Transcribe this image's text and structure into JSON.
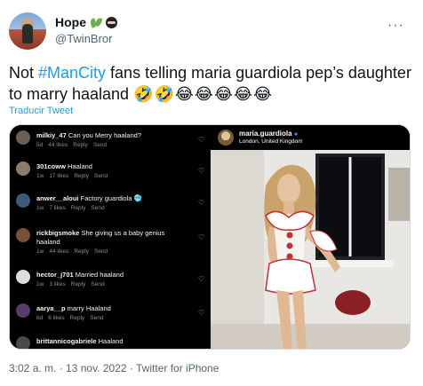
{
  "author": {
    "name": "Hope",
    "handle": "@TwinBror"
  },
  "more_label": "···",
  "tweet": {
    "text_before": "Not ",
    "hashtag": "#ManCity",
    "text_after": " fans telling maria guardiola pep’s daughter to marry haaland ",
    "emojis": "🤣🤣😂😂😂😂😂",
    "translate_label": "Traducir Tweet"
  },
  "comments": [
    {
      "user": "milkiy_47",
      "text": "Can you Merry haaland?",
      "age": "5d",
      "likes": "44 likes",
      "reply": "Reply",
      "send": "Send"
    },
    {
      "user": "301coww",
      "text": "Haaland",
      "age": "1w",
      "likes": "17 likes",
      "reply": "Reply",
      "send": "Send"
    },
    {
      "user": "anwer__aloui",
      "text": "Factory guardiola 🥶",
      "age": "1w",
      "likes": "7 likes",
      "reply": "Reply",
      "send": "Send"
    },
    {
      "user": "rickbigsmoke",
      "text": "She giving us a baby genius haaland",
      "age": "1w",
      "likes": "44 likes",
      "reply": "Reply",
      "send": "Send"
    },
    {
      "user": "hector_j701",
      "text": "Married haaland",
      "age": "1w",
      "likes": "3 likes",
      "reply": "Reply",
      "send": "Send"
    },
    {
      "user": "aarya__p",
      "text": "marry Haaland",
      "age": "6d",
      "likes": "6 likes",
      "reply": "Reply",
      "send": "Send"
    },
    {
      "user": "brittannicogabriele",
      "text": "Haaland",
      "age": "",
      "likes": "",
      "reply": "",
      "send": ""
    }
  ],
  "post": {
    "username": "maria.guardiola",
    "location": "London, United Kingdom"
  },
  "footer": {
    "time": "3:02 a. m.",
    "separator1": " · ",
    "date": "13 nov. 2022",
    "separator2": " · ",
    "source": "Twitter for iPhone"
  },
  "colors": {
    "link": "#1d9bf0",
    "muted": "#536471",
    "text": "#0f1419"
  }
}
